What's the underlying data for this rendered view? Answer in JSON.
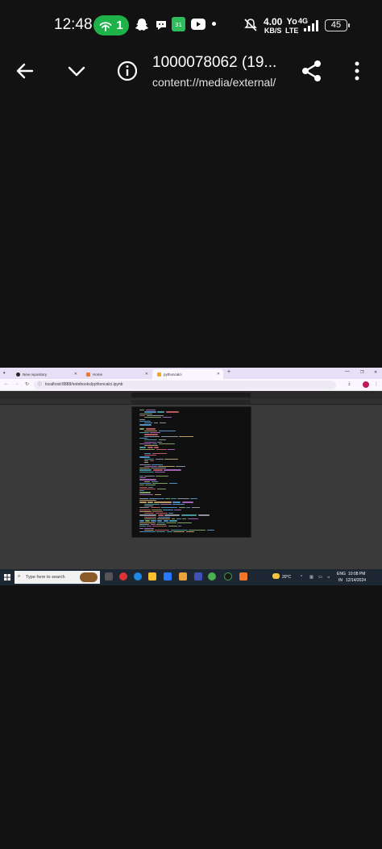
{
  "status_bar": {
    "time": "12:48",
    "hotspot_count": "1",
    "speed_value": "4.00",
    "speed_unit": "KB/S",
    "carrier_top": "Yo",
    "carrier_bottom": "LTE",
    "network": "4G",
    "battery": "45"
  },
  "app_bar": {
    "title": "1000078062 (19...",
    "subtitle": "content://media/external/"
  },
  "screenshot": {
    "tabs": [
      {
        "label": "New repository"
      },
      {
        "label": "Home"
      },
      {
        "label": "pythoncalci"
      }
    ],
    "new_tab": "+",
    "url": "localhost:8888/notebooks/pythoncalci.ipynb",
    "taskbar": {
      "search_placeholder": "Type here to search",
      "weather": "20°C",
      "lang_top": "ENG",
      "lang_bottom": "IN",
      "time": "10:08 PM",
      "date": "12/14/2024"
    }
  }
}
